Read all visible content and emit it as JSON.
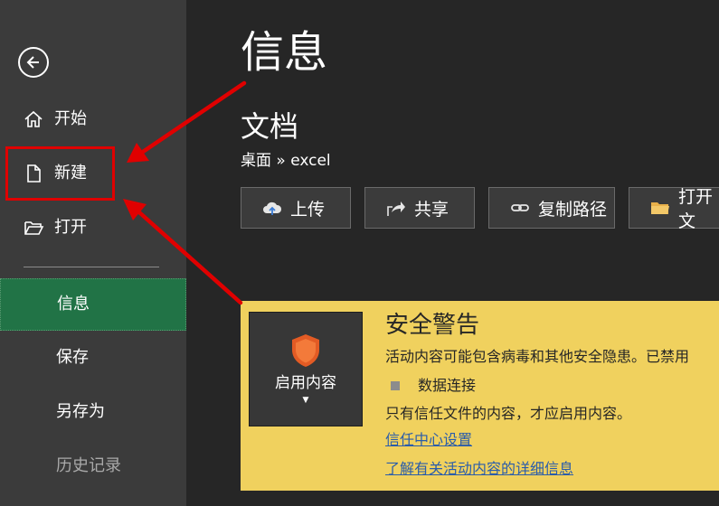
{
  "sidebar": {
    "back": {
      "icon": "back-arrow-icon"
    },
    "items": [
      {
        "label": "开始",
        "icon": "home-icon"
      },
      {
        "label": "新建",
        "icon": "new-document-icon"
      },
      {
        "label": "打开",
        "icon": "open-folder-icon"
      },
      {
        "label": "信息"
      },
      {
        "label": "保存"
      },
      {
        "label": "另存为"
      },
      {
        "label": "历史记录"
      }
    ],
    "active_item": "信息"
  },
  "main": {
    "title": "信息",
    "document": {
      "name": "文档",
      "path": "桌面 » excel"
    },
    "actions": [
      {
        "label": "上传",
        "icon": "upload-cloud-icon"
      },
      {
        "label": "共享",
        "icon": "share-icon"
      },
      {
        "label": "复制路径",
        "icon": "link-icon"
      },
      {
        "label": "打开文",
        "icon": "folder-icon"
      }
    ]
  },
  "security_warning": {
    "title": "安全警告",
    "enable_button": {
      "label": "启用内容",
      "icon": "shield-icon"
    },
    "text": "活动内容可能包含病毒和其他安全隐患。已禁用",
    "item": "数据连接",
    "note": "只有信任文件的内容，才应启用内容。",
    "links": [
      "信任中心设置",
      "了解有关活动内容的详细信息"
    ]
  },
  "colors": {
    "sidebar_bg": "#3b3b3b",
    "main_bg": "#262626",
    "active_green": "#217346",
    "warning_bg": "#f0d15e",
    "annotation_red": "#e00000",
    "link_blue": "#2a5caa"
  }
}
